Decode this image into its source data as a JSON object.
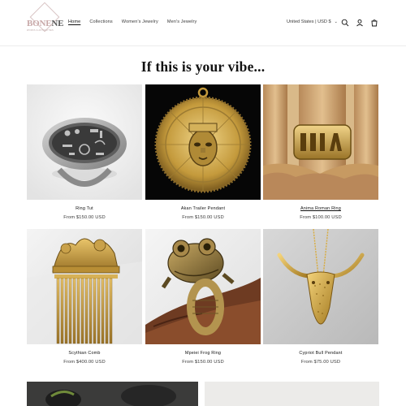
{
  "header": {
    "logo_word_a": "BONE",
    "logo_word_b": "NE",
    "logo_sub": "WORKS & ANTIQUITIES",
    "nav": [
      "Home",
      "Collections",
      "Women's Jewelry",
      "Men's Jewelry"
    ],
    "active_nav": "Home",
    "country": "United States | USD $",
    "icons": [
      "search-icon",
      "account-icon",
      "cart-icon"
    ]
  },
  "section_title": "If this is your vibe...",
  "products": [
    {
      "name": "Ring Tut",
      "price": "From $150.00 USD"
    },
    {
      "name": "Akan Trailer Pendant",
      "price": "From $150.00 USD"
    },
    {
      "name": "Anima Roman Ring",
      "price": "From $100.00 USD"
    },
    {
      "name": "Scythian Comb",
      "price": "From $400.00 USD"
    },
    {
      "name": "Mpeiei Frog Ring",
      "price": "From $150.00 USD"
    },
    {
      "name": "Cypriot Bull Pendant",
      "price": "From $75.00 USD"
    }
  ],
  "colors": {
    "gold": "#c9a14a",
    "dark_gold": "#8a6a2a",
    "text": "#121212"
  }
}
